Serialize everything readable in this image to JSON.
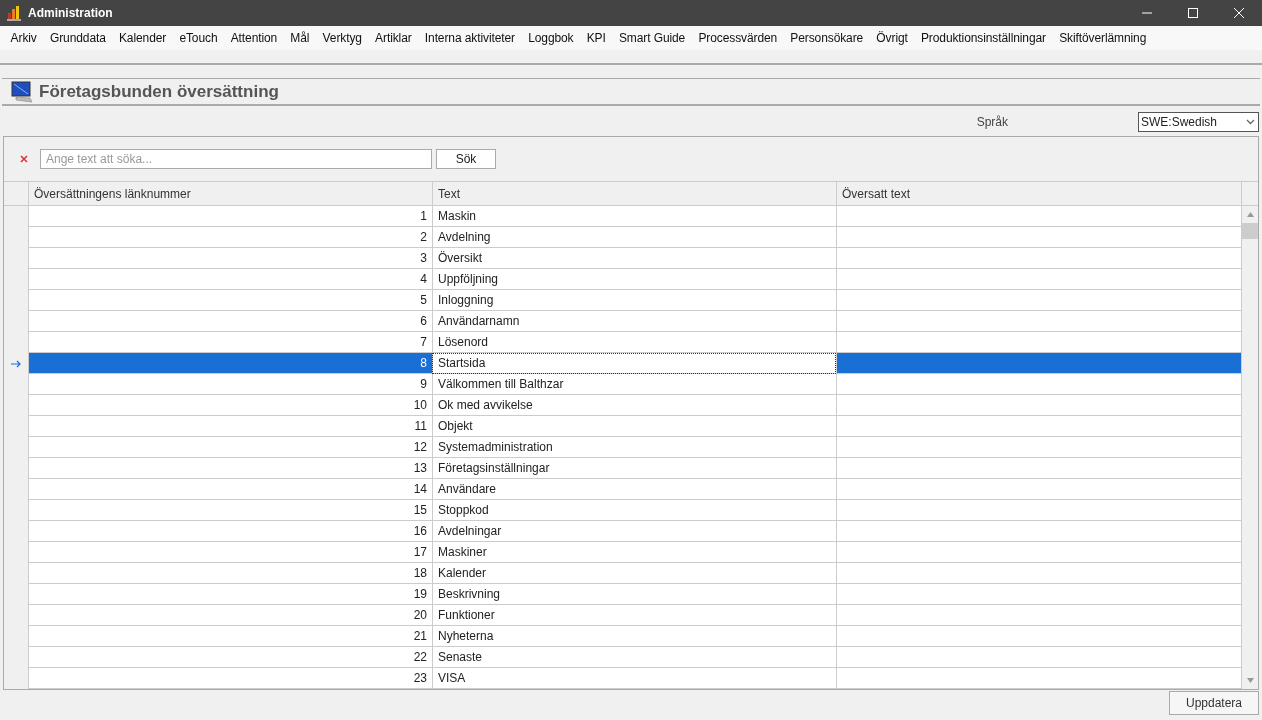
{
  "window": {
    "title": "Administration"
  },
  "menu": [
    "Arkiv",
    "Grunddata",
    "Kalender",
    "eTouch",
    "Attention",
    "Mål",
    "Verktyg",
    "Artiklar",
    "Interna aktiviteter",
    "Loggbok",
    "KPI",
    "Smart Guide",
    "Processvärden",
    "Personsökare",
    "Övrigt",
    "Produktionsinställningar",
    "Skiftöverlämning"
  ],
  "page_title": "Företagsbunden översättning",
  "language": {
    "label": "Språk",
    "value": "SWE:Swedish"
  },
  "search": {
    "placeholder": "Ange text att söka...",
    "button": "Sök"
  },
  "table": {
    "columns": [
      "Översättningens länknummer",
      "Text",
      "Översatt text"
    ],
    "rows": [
      {
        "number": "1",
        "text": "Maskin",
        "selected": false
      },
      {
        "number": "2",
        "text": "Avdelning",
        "selected": false
      },
      {
        "number": "3",
        "text": "Översikt",
        "selected": false
      },
      {
        "number": "4",
        "text": "Uppföljning",
        "selected": false
      },
      {
        "number": "5",
        "text": "Inloggning",
        "selected": false
      },
      {
        "number": "6",
        "text": "Användarnamn",
        "selected": false
      },
      {
        "number": "7",
        "text": "Lösenord",
        "selected": false
      },
      {
        "number": "8",
        "text": "Startsida",
        "selected": true
      },
      {
        "number": "9",
        "text": "Välkommen till Balthzar",
        "selected": false
      },
      {
        "number": "10",
        "text": "Ok med avvikelse",
        "selected": false
      },
      {
        "number": "11",
        "text": "Objekt",
        "selected": false
      },
      {
        "number": "12",
        "text": "Systemadministration",
        "selected": false
      },
      {
        "number": "13",
        "text": "Företagsinställningar",
        "selected": false
      },
      {
        "number": "14",
        "text": "Användare",
        "selected": false
      },
      {
        "number": "15",
        "text": "Stoppkod",
        "selected": false
      },
      {
        "number": "16",
        "text": "Avdelningar",
        "selected": false
      },
      {
        "number": "17",
        "text": "Maskiner",
        "selected": false
      },
      {
        "number": "18",
        "text": "Kalender",
        "selected": false
      },
      {
        "number": "19",
        "text": "Beskrivning",
        "selected": false
      },
      {
        "number": "20",
        "text": "Funktioner",
        "selected": false
      },
      {
        "number": "21",
        "text": "Nyheterna",
        "selected": false
      },
      {
        "number": "22",
        "text": "Senaste",
        "selected": false
      },
      {
        "number": "23",
        "text": "VISA",
        "selected": false
      }
    ]
  },
  "update_button": "Uppdatera"
}
